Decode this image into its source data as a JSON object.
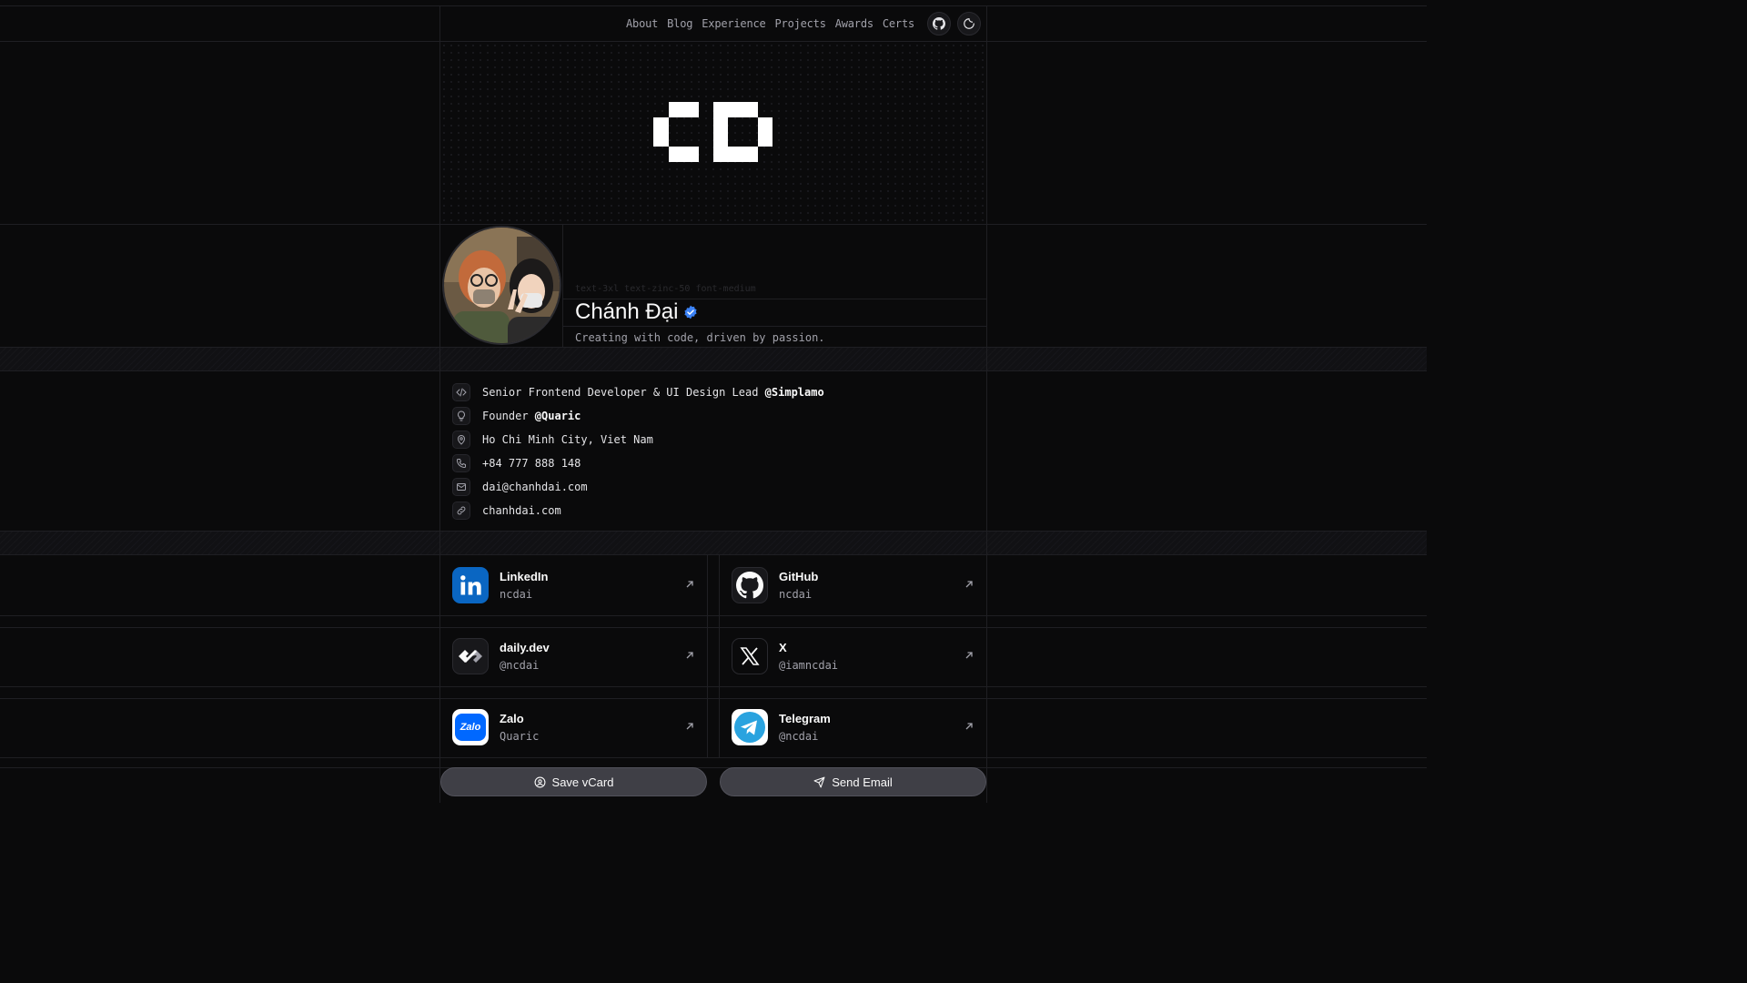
{
  "nav": {
    "links": [
      "About",
      "Blog",
      "Experience",
      "Projects",
      "Awards",
      "Certs"
    ],
    "github_icon": "github-icon",
    "theme_icon": "theme-toggle-icon"
  },
  "profile": {
    "ghost_text": "text-3xl text-zinc-50 font-medium",
    "name": "Chánh Đại",
    "tagline": "Creating with code, driven by passion.",
    "verified_color": "#3b82f6"
  },
  "info": {
    "role_prefix": "Senior Frontend Developer & UI Design Lead ",
    "role_company": "@Simplamo",
    "founder_prefix": "Founder ",
    "founder_company": "@Quaric",
    "location": "Ho Chi Minh City, Viet Nam",
    "phone": "+84 777 888 148",
    "email": "dai@chanhdai.com",
    "website": "chanhdai.com"
  },
  "socials": [
    {
      "title": "LinkedIn",
      "handle": "ncdai",
      "icon": "linkedin-icon"
    },
    {
      "title": "GitHub",
      "handle": "ncdai",
      "icon": "github-icon"
    },
    {
      "title": "daily.dev",
      "handle": "@ncdai",
      "icon": "dailydev-icon"
    },
    {
      "title": "X",
      "handle": "@iamncdai",
      "icon": "x-icon"
    },
    {
      "title": "Zalo",
      "handle": "Quaric",
      "icon": "zalo-icon"
    },
    {
      "title": "Telegram",
      "handle": "@ncdai",
      "icon": "telegram-icon"
    }
  ],
  "zalo_logo_text": "Zalo",
  "buttons": {
    "vcard": "Save vCard",
    "email": "Send Email"
  }
}
